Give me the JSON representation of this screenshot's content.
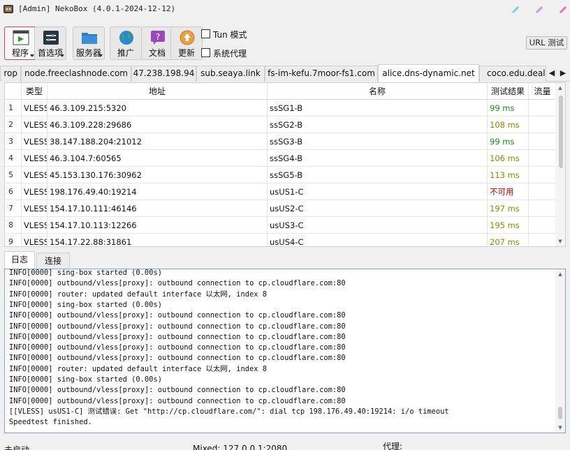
{
  "window": {
    "title": "[Admin] NekoBox (4.0.1-2024-12-12)",
    "controls": [
      {
        "name": "minimize-button",
        "color": "#7ec8e8"
      },
      {
        "name": "maximize-button",
        "color": "#d78ae8"
      },
      {
        "name": "close-button",
        "color": "#f06ab0"
      }
    ]
  },
  "toolbar": {
    "buttons": [
      {
        "label": "程序",
        "icon": "program-icon",
        "dropdown": true
      },
      {
        "label": "首选项",
        "icon": "preferences-icon",
        "dropdown": true
      },
      {
        "label": "服务器",
        "icon": "server-icon",
        "dropdown": true
      },
      {
        "label": "推广",
        "icon": "globe-icon",
        "dropdown": false
      },
      {
        "label": "文档",
        "icon": "docs-icon",
        "dropdown": false
      },
      {
        "label": "更新",
        "icon": "update-icon",
        "dropdown": false
      }
    ],
    "tun_label": "Tun 模式",
    "system_proxy_label": "系统代理",
    "url_test_label": "URL 测试"
  },
  "group_tabs": {
    "items": [
      "rop",
      "node.freeclashnode.com",
      "47.238.198.94",
      "sub.seaya.link",
      "fs-im-kefu.7moor-fs1.com",
      "alice.dns-dynamic.net",
      "coco.edu.deal"
    ],
    "selected": "alice.dns-dynamic.net"
  },
  "table": {
    "headers": {
      "type": "类型",
      "address": "地址",
      "name": "名称",
      "test": "测试结果",
      "traffic": "流量"
    },
    "rows": [
      {
        "idx": "1",
        "type": "VLESS",
        "address": "46.3.109.215:5320",
        "name": "ssSG1-B",
        "test": "99 ms",
        "color": "#1a8a1a"
      },
      {
        "idx": "2",
        "type": "VLESS",
        "address": "46.3.109.228:29686",
        "name": "ssSG2-B",
        "test": "108 ms",
        "color": "#8a8a00"
      },
      {
        "idx": "3",
        "type": "VLESS",
        "address": "38.147.188.204:21012",
        "name": "ssSG3-B",
        "test": "99 ms",
        "color": "#1a8a1a"
      },
      {
        "idx": "4",
        "type": "VLESS",
        "address": "46.3.104.7:60565",
        "name": "ssSG4-B",
        "test": "106 ms",
        "color": "#8a8a00"
      },
      {
        "idx": "5",
        "type": "VLESS",
        "address": "45.153.130.176:30962",
        "name": "ssSG5-B",
        "test": "113 ms",
        "color": "#8a8a00"
      },
      {
        "idx": "6",
        "type": "VLESS",
        "address": "198.176.49.40:19214",
        "name": "usUS1-C",
        "test": "不可用",
        "color": "#c00000"
      },
      {
        "idx": "7",
        "type": "VLESS",
        "address": "154.17.10.111:46146",
        "name": "usUS2-C",
        "test": "197 ms",
        "color": "#8a8a00"
      },
      {
        "idx": "8",
        "type": "VLESS",
        "address": "154.17.10.113:12266",
        "name": "usUS3-C",
        "test": "195 ms",
        "color": "#8a8a00"
      },
      {
        "idx": "9",
        "type": "VLESS",
        "address": "154.17.22.88:31861",
        "name": "usUS4-C",
        "test": "207 ms",
        "color": "#8a8a00"
      }
    ]
  },
  "bottom_tabs": {
    "log": "日志",
    "connections": "连接"
  },
  "log": {
    "lines": [
      "INFO[0000] sing-box started (0.00s)",
      "INFO[0000] outbound/vless[proxy]: outbound connection to cp.cloudflare.com:80",
      "INFO[0000] router: updated default interface 以太网, index 8",
      "INFO[0000] sing-box started (0.00s)",
      "INFO[0000] outbound/vless[proxy]: outbound connection to cp.cloudflare.com:80",
      "INFO[0000] outbound/vless[proxy]: outbound connection to cp.cloudflare.com:80",
      "INFO[0000] outbound/vless[proxy]: outbound connection to cp.cloudflare.com:80",
      "INFO[0000] outbound/vless[proxy]: outbound connection to cp.cloudflare.com:80",
      "INFO[0000] outbound/vless[proxy]: outbound connection to cp.cloudflare.com:80",
      "INFO[0000] router: updated default interface 以太网, index 8",
      "INFO[0000] sing-box started (0.00s)",
      "INFO[0000] outbound/vless[proxy]: outbound connection to cp.cloudflare.com:80",
      "INFO[0000] outbound/vless[proxy]: outbound connection to cp.cloudflare.com:80",
      "[[VLESS] usUS1-C] 测试错误: Get \"http://cp.cloudflare.com/\": dial tcp 198.176.49.40:19214: i/o timeout",
      "Speedtest finished."
    ]
  },
  "status_bar": {
    "left": "未启动",
    "middle": "Mixed: 127.0.0.1:2080",
    "right": "代理:"
  }
}
